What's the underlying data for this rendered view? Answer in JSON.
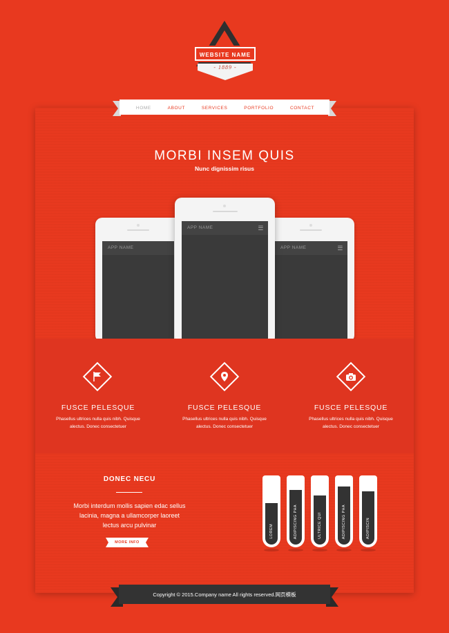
{
  "logo": {
    "name": "WEBSITE NAME",
    "year": "- 1889 -"
  },
  "nav": {
    "items": [
      "HOME",
      "ABOUT",
      "SERVICES",
      "PORTFOLIO",
      "CONTACT"
    ]
  },
  "hero": {
    "title": "MORBI INSEM QUIS",
    "subtitle": "Nunc dignissim risus"
  },
  "phones": {
    "app_name": "APP NAME",
    "menu_glyph": "☰"
  },
  "features": [
    {
      "icon": "flag-icon",
      "title": "FUSCE PELESQUE",
      "text1": "Phasellus ultrices nulla quis nibh. Quisque",
      "text2": "alectus. Donec consectetuer"
    },
    {
      "icon": "location-pin-icon",
      "title": "FUSCE PELESQUE",
      "text1": "Phasellus ultrices nulla quis nibh. Quisque",
      "text2": "alectus. Donec consectetuer"
    },
    {
      "icon": "camera-icon",
      "title": "FUSCE PELESQUE",
      "text1": "Phasellus ultrices nulla quis nibh. Quisque",
      "text2": "alectus. Donec consectetuer"
    }
  ],
  "donec": {
    "title": "DONEC NECU",
    "line1": "Morbi interdum mollis sapien edac sellus",
    "line2": "lacinia, magna a ullamcorper laoreet",
    "line3": "lectus arcu pulvinar",
    "button": "MORE INFO"
  },
  "tubes": [
    {
      "label": "LOREM",
      "fill": 0.62
    },
    {
      "label": "ADIPISCING PHA",
      "fill": 0.82
    },
    {
      "label": "ULTRICE QUI",
      "fill": 0.74
    },
    {
      "label": "ADIPISCING PHA",
      "fill": 0.88
    },
    {
      "label": "ADIPISCIN",
      "fill": 0.8
    }
  ],
  "footer": {
    "text": "Copyright © 2015.Company name All rights reserved.网页模板"
  },
  "colors": {
    "accent": "#e8391f",
    "dark": "#333333",
    "white": "#ffffff"
  }
}
